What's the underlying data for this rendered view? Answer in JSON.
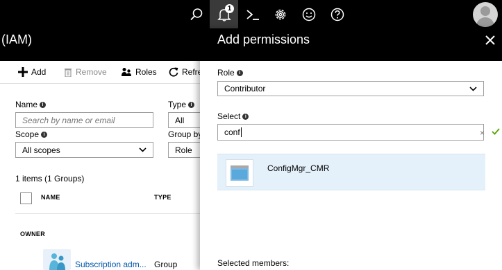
{
  "topbar": {
    "icons": [
      "search-icon",
      "notification-bell-icon",
      "cloud-shell-icon",
      "settings-gear-icon",
      "feedback-smiley-icon",
      "help-question-icon",
      "user-avatar"
    ],
    "notification_count": "1"
  },
  "left_blade": {
    "title": "(IAM)",
    "commands": {
      "add": "Add",
      "remove": "Remove",
      "roles": "Roles",
      "refresh": "Refre"
    },
    "filters": {
      "name_label": "Name",
      "name_placeholder": "Search by name or email",
      "type_label": "Type",
      "type_value": "All",
      "scope_label": "Scope",
      "scope_value": "All scopes",
      "group_by_label": "Group by",
      "group_by_value": "Role"
    },
    "items_count": "1 items (1 Groups)",
    "columns": {
      "name": "NAME",
      "type": "TYPE"
    },
    "group_header": "OWNER",
    "rows": [
      {
        "name": "Subscription adm...",
        "type": "Group"
      }
    ]
  },
  "add_permissions": {
    "title": "Add permissions",
    "role_label": "Role",
    "role_value": "Contributor",
    "select_label": "Select",
    "select_value": "conf",
    "results": [
      {
        "name": "ConfigMgr_CMR"
      }
    ],
    "selected_members_label": "Selected members:"
  },
  "colors": {
    "header_bg": "#000000",
    "link_blue": "#0058ad",
    "result_highlight": "#e4f1fb",
    "valid_check": "#57a300"
  }
}
